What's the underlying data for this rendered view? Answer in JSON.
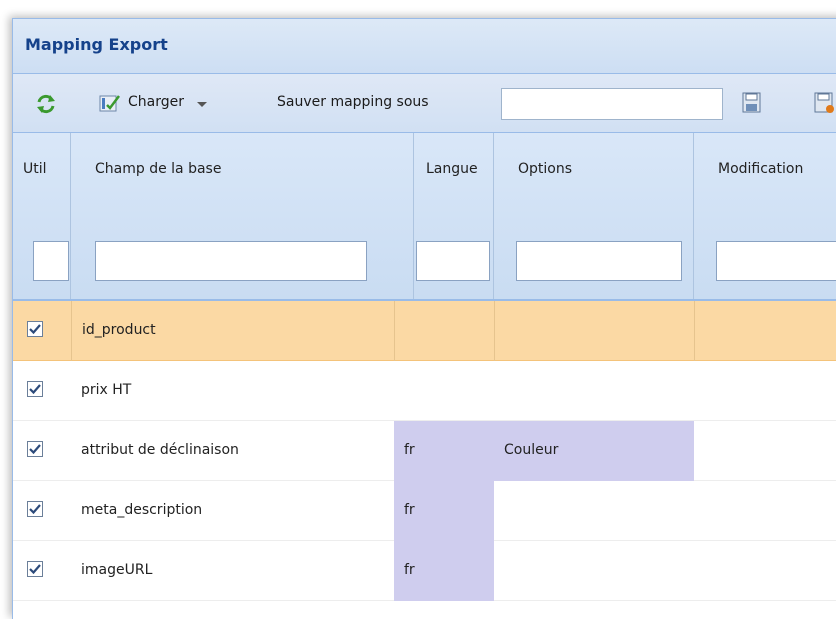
{
  "panel": {
    "title": "Mapping Export"
  },
  "toolbar": {
    "refresh_icon": "refresh-icon",
    "charger_label": "Charger",
    "save_as_label": "Sauver mapping sous",
    "save_name_value": "",
    "save_icon": "save-icon",
    "save_icon2": "save-as-icon"
  },
  "columns": [
    {
      "key": "use",
      "label": "Util"
    },
    {
      "key": "field",
      "label": "Champ de la base"
    },
    {
      "key": "lang",
      "label": "Langue"
    },
    {
      "key": "options",
      "label": "Options"
    },
    {
      "key": "modification",
      "label": "Modification"
    }
  ],
  "rows": [
    {
      "checked": true,
      "field": "id_product",
      "lang": "",
      "options": "",
      "selected": true
    },
    {
      "checked": true,
      "field": "prix HT",
      "lang": "",
      "options": "",
      "selected": false
    },
    {
      "checked": true,
      "field": "attribut de déclinaison",
      "lang": "fr",
      "options": "Couleur",
      "selected": false
    },
    {
      "checked": true,
      "field": "meta_description",
      "lang": "fr",
      "options": "",
      "selected": false
    },
    {
      "checked": true,
      "field": "imageURL",
      "lang": "fr",
      "options": "",
      "selected": false
    }
  ],
  "colors": {
    "selected_row": "#fbd9a4",
    "lang_cell": "#cfcdee",
    "header": "#d9e7f8",
    "title_text": "#15428b"
  }
}
